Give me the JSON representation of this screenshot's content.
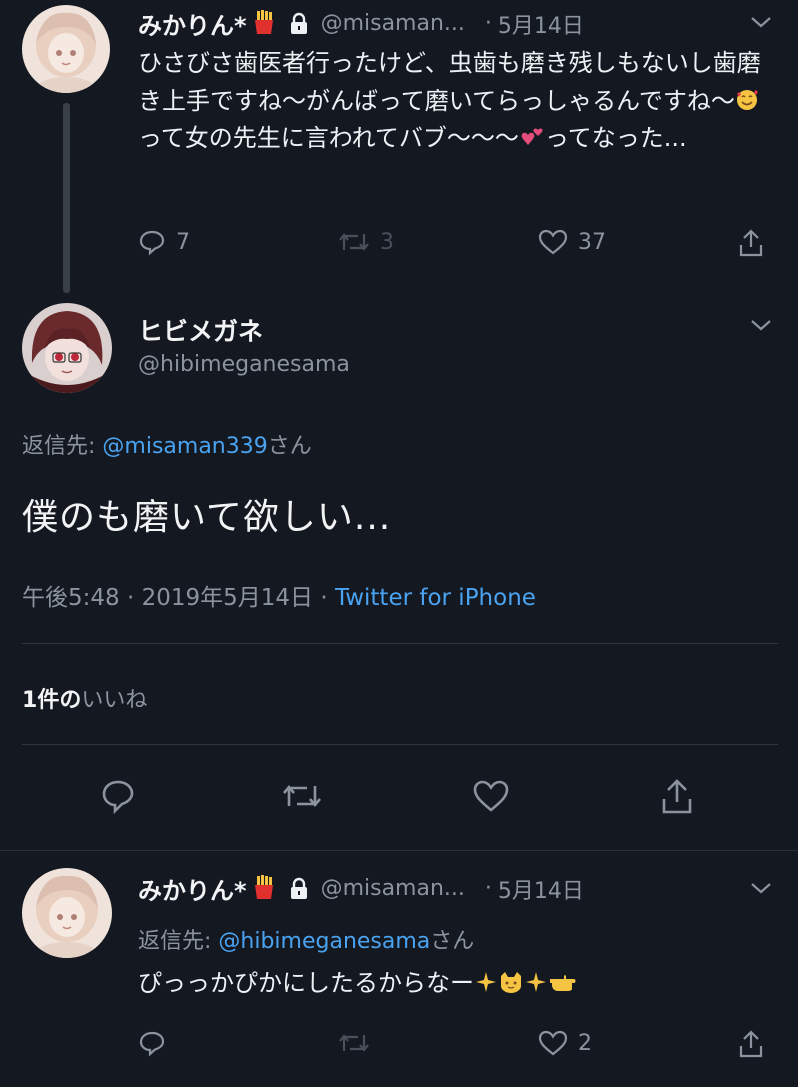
{
  "tweets": [
    {
      "display_name": "みかりん*",
      "name_badge_icon": "fries-emoji",
      "locked": true,
      "handle": "@misaman...",
      "separator": "·",
      "date": "5月14日",
      "text_segments": [
        "ひさびさ歯医者行ったけど、虫歯も磨き残しもないし歯磨き上手ですね〜がんばって磨いてらっしゃるんですね〜",
        "って女の先生に言われてバブ〜〜〜",
        "ってなった..."
      ],
      "text_emojis": [
        "smiling-face-with-hearts-emoji",
        "two-hearts-emoji"
      ],
      "replies": "7",
      "retweets": "3",
      "likes": "37"
    },
    {
      "display_name": "ヒビメガネ",
      "handle": "@hibimeganesama",
      "reply_prefix": "返信先: ",
      "reply_mention": "@misaman339",
      "reply_suffix": "さん",
      "text": "僕のも磨いて欲しい...",
      "time": "午後5:48",
      "meta_separator": " · ",
      "full_date": "2019年5月14日",
      "source": "Twitter for iPhone",
      "like_count": "1",
      "like_label_1": "件の",
      "like_label_2": "いいね"
    },
    {
      "display_name": "みかりん*",
      "name_badge_icon": "fries-emoji",
      "locked": true,
      "handle": "@misaman...",
      "separator": "·",
      "date": "5月14日",
      "reply_prefix": "返信先: ",
      "reply_mention": "@hibimeganesama",
      "reply_suffix": "さん",
      "text": "ぴっっかぴかにしたるからなー",
      "text_emojis": [
        "sparkles-emoji",
        "cat-face-emoji",
        "sparkles-emoji",
        "pointing-hand-emoji"
      ],
      "replies": "",
      "retweets": "",
      "likes": "2"
    }
  ],
  "colors": {
    "background": "#141821",
    "text": "#eef1f4",
    "secondary": "#8b949e",
    "link": "#4aa3f0"
  }
}
